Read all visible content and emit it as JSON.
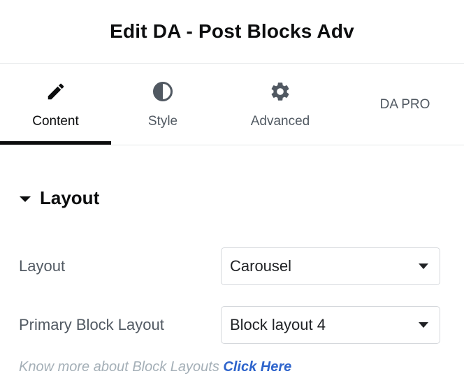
{
  "header": {
    "title": "Edit DA - Post Blocks Adv"
  },
  "tabs": [
    {
      "label": "Content",
      "icon": "pencil-icon",
      "active": true
    },
    {
      "label": "Style",
      "icon": "half-circle-contrast-icon",
      "active": false
    },
    {
      "label": "Advanced",
      "icon": "gear-icon",
      "active": false
    },
    {
      "label": "DA PRO",
      "icon": "",
      "active": false
    }
  ],
  "section": {
    "title": "Layout",
    "expanded": true
  },
  "controls": {
    "layout": {
      "label": "Layout",
      "value": "Carousel"
    },
    "primary_block_layout": {
      "label": "Primary Block Layout",
      "value": "Block layout 4"
    }
  },
  "help": {
    "text": "Know more about Block Layouts",
    "link_text": "Click Here"
  },
  "colors": {
    "accent": "#0c0d0e",
    "link": "#2e64cc",
    "muted": "#a4afb7",
    "label": "#515962",
    "icon": "#515962"
  }
}
